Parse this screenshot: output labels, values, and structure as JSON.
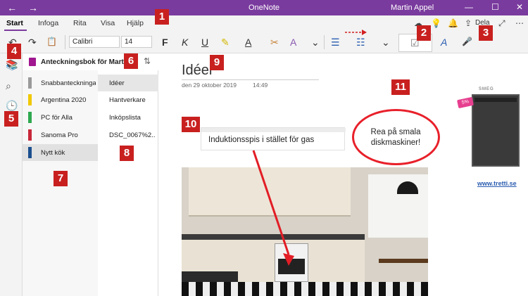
{
  "window": {
    "title": "OneNote",
    "user": "Martin Appel",
    "back_icon": "←",
    "forward_icon": "→",
    "minimize_icon": "—",
    "maximize_icon": "☐",
    "close_icon": "✕"
  },
  "ribbon": {
    "tabs": [
      "Start",
      "Infoga",
      "Rita",
      "Visa",
      "Hjälp"
    ],
    "active_tab": "Start",
    "share_label": "Dela",
    "accent_color": "#7a3b9e"
  },
  "toolbar": {
    "undo_icon": "↶",
    "redo_icon": "↷",
    "clipboard_icon": "📋",
    "font_name": "Calibri",
    "font_size": "14",
    "bold_label": "F",
    "italic_label": "K",
    "underline_label": "U",
    "highlight_icon": "✎",
    "font_color_label": "A",
    "format_painter_icon": "✂",
    "clear_format_label": "A",
    "more_icon": "⌄",
    "bullets_icon": "☰",
    "numbering_icon": "☷",
    "list_more_icon": "⌄",
    "todo_icon": "☑",
    "styles_icon": "A",
    "dictate_icon": "🎤"
  },
  "rail": {
    "notebooks_icon": "📚",
    "search_icon": "⌕",
    "recent_icon": "🕒"
  },
  "notebook": {
    "name": "Anteckningsbok för Martin",
    "sort_icon": "⇅"
  },
  "sections": [
    {
      "label": "Snabbanteckningar",
      "color": "#9a9a9a"
    },
    {
      "label": "Argentina 2020",
      "color": "#f0c800"
    },
    {
      "label": "PC för Alla",
      "color": "#2fa84f"
    },
    {
      "label": "Sanoma Pro",
      "color": "#c8283a"
    },
    {
      "label": "Nytt kök",
      "color": "#1b4f8e"
    }
  ],
  "selected_section": "Nytt kök",
  "pages": [
    {
      "label": "Idéer"
    },
    {
      "label": "Hantverkare"
    },
    {
      "label": "Inköpslista"
    },
    {
      "label": "DSC_0067%2..."
    }
  ],
  "selected_page": "Idéer",
  "page": {
    "title": "Idéer",
    "date": "den 29 oktober 2019",
    "time": "14:49",
    "note": "Induktionsspis i stället för gas",
    "bubble_line1": "Rea på smala",
    "bubble_line2": "diskmaskiner!",
    "ad_brand": "SMEG",
    "ad_discount": "5%",
    "ad_link": "www.tretti.se"
  },
  "badges": [
    "1",
    "2",
    "3",
    "4",
    "5",
    "6",
    "7",
    "8",
    "9",
    "10",
    "11"
  ],
  "badge_color": "#c8201f"
}
